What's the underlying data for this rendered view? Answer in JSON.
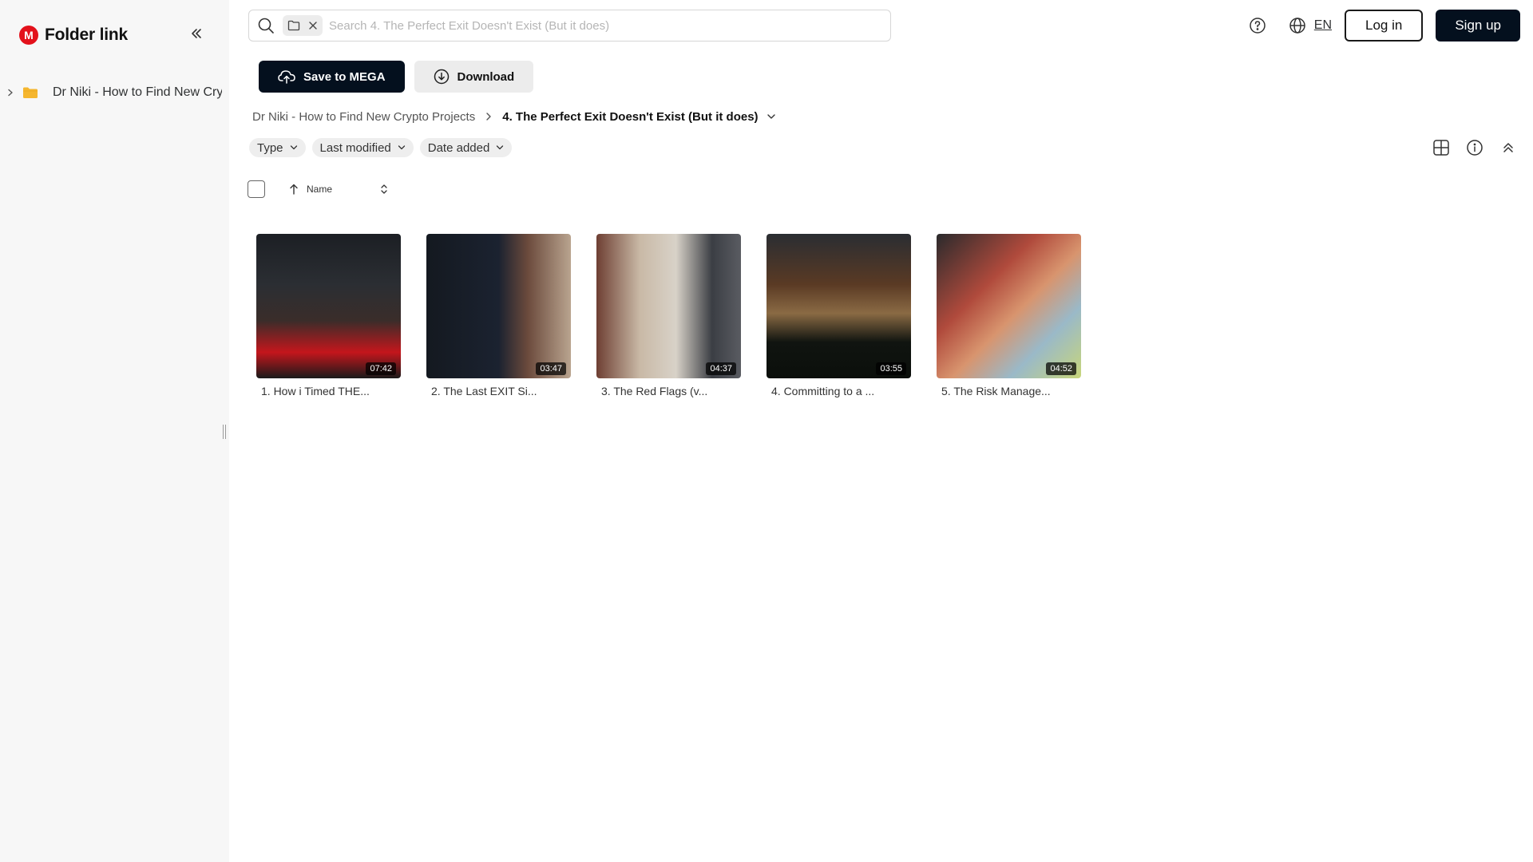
{
  "sidebar": {
    "logo_letter": "M",
    "title": "Folder link",
    "tree_item_label": "Dr Niki - How to Find New Crypto Projects"
  },
  "search": {
    "placeholder": "Search 4. The Perfect Exit Doesn't Exist (But it does)"
  },
  "header": {
    "language": "EN",
    "login_label": "Log in",
    "signup_label": "Sign up"
  },
  "actions": {
    "save_label": "Save to MEGA",
    "download_label": "Download"
  },
  "breadcrumb": {
    "parent": "Dr Niki - How to Find New Crypto Projects",
    "current": "4. The Perfect Exit Doesn't Exist (But it does)"
  },
  "filters": {
    "type": "Type",
    "last_modified": "Last modified",
    "date_added": "Date added"
  },
  "list_header": {
    "name": "Name"
  },
  "files": [
    {
      "name": "1. How i Timed THE...",
      "duration": "07:42"
    },
    {
      "name": "2. The Last EXIT Si...",
      "duration": "03:47"
    },
    {
      "name": "3. The Red Flags (v...",
      "duration": "04:37"
    },
    {
      "name": "4. Committing to a ...",
      "duration": "03:55"
    },
    {
      "name": "5. The Risk Manage...",
      "duration": "04:52"
    }
  ],
  "colors": {
    "brand_red": "#e3111b",
    "primary_dark": "#04101e",
    "folder_yellow": "#f5b62e",
    "sidebar_bg": "#f7f7f7"
  },
  "icons": [
    "search-icon",
    "folder-icon",
    "close-icon",
    "help-icon",
    "globe-icon",
    "cloud-upload-icon",
    "download-icon",
    "chevron-right-icon",
    "chevron-down-icon",
    "grid-view-icon",
    "info-icon",
    "collapse-up-icon",
    "arrow-up-icon",
    "sort-toggle-icon",
    "double-chevron-left-icon"
  ]
}
